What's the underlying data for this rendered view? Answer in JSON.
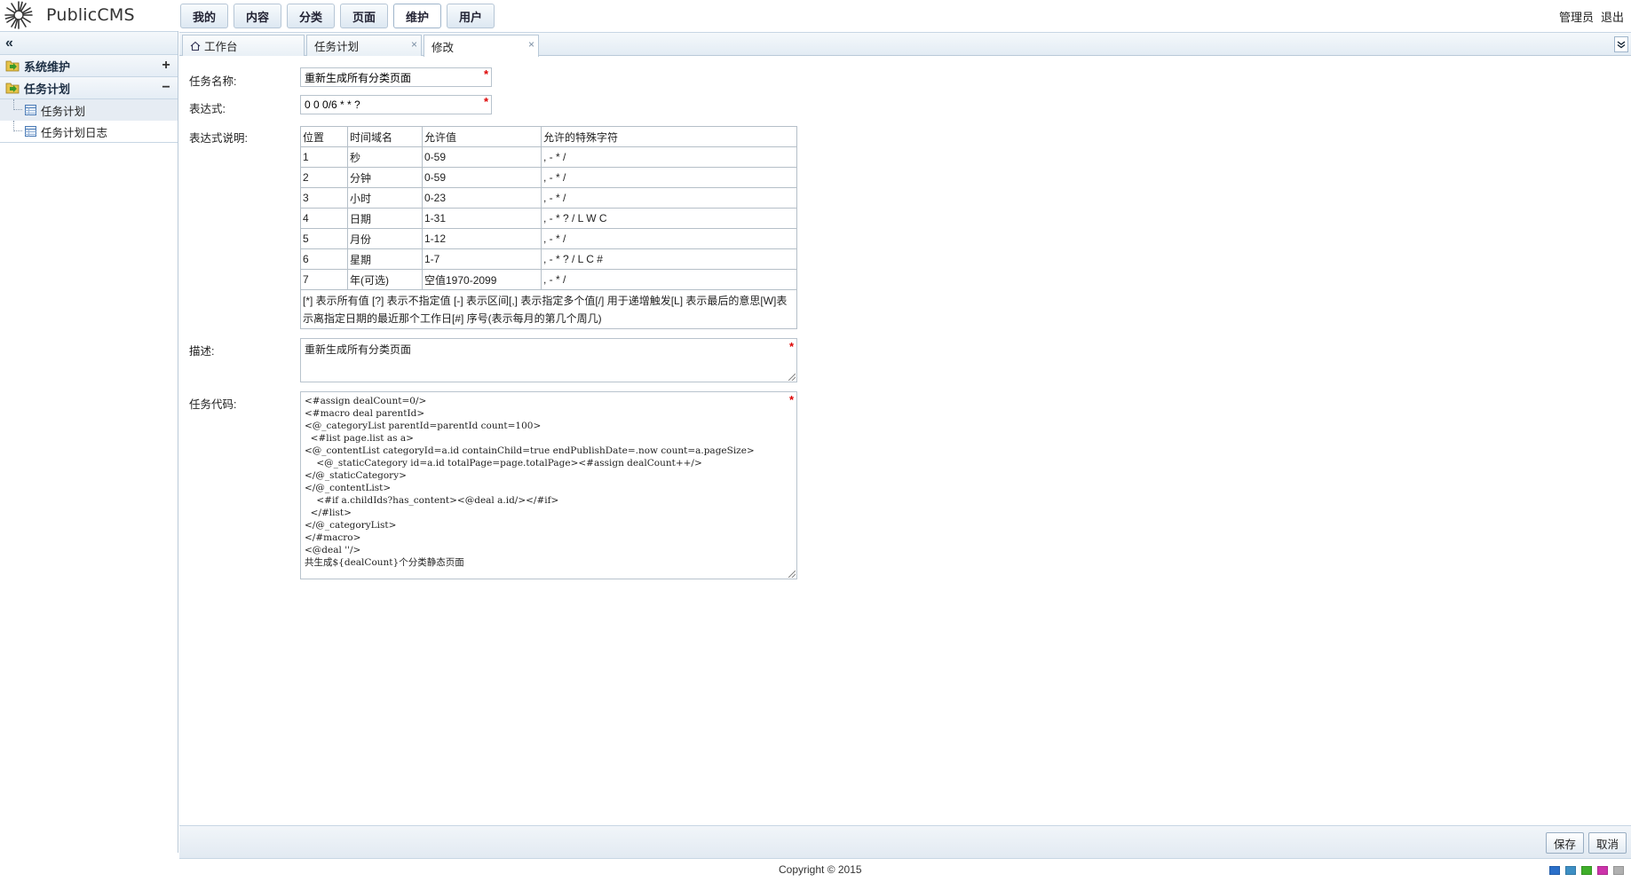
{
  "app": {
    "logo_text": "PublicCMS"
  },
  "topnav": {
    "items": [
      {
        "label": "我的"
      },
      {
        "label": "内容"
      },
      {
        "label": "分类"
      },
      {
        "label": "页面"
      },
      {
        "label": "维护"
      },
      {
        "label": "用户"
      }
    ],
    "active_index": 4
  },
  "userbar": {
    "user_label": "管理员",
    "logout_label": "退出"
  },
  "sidebar": {
    "collapse_glyph": "«",
    "sections": [
      {
        "label": "系统维护",
        "toggle": "+"
      },
      {
        "label": "任务计划",
        "toggle": "−"
      }
    ],
    "items": [
      {
        "label": "任务计划"
      },
      {
        "label": "任务计划日志"
      }
    ],
    "selected_index": 0
  },
  "tabs": {
    "items": [
      {
        "label": "工作台"
      },
      {
        "label": "任务计划"
      },
      {
        "label": "修改"
      }
    ],
    "active_index": 2,
    "close_glyph": "×",
    "expand_glyph": "⌄"
  },
  "form": {
    "name_label": "任务名称:",
    "name_value": "重新生成所有分类页面",
    "cron_label": "表达式:",
    "cron_value": "0 0 0/6 * * ?",
    "cron_help_label": "表达式说明:",
    "description_label": "描述:",
    "description_value": "重新生成所有分类页面",
    "code_label": "任务代码:",
    "required_mark": "*",
    "code_lines": [
      "<#assign dealCount=0/>",
      "<#macro deal parentId>",
      "<@_categoryList parentId=parentId count=100>",
      "  <#list page.list as a>",
      "<@_contentList categoryId=a.id containChild=true endPublishDate=.now count=a.pageSize>",
      "    <@_staticCategory id=a.id totalPage=page.totalPage><#assign dealCount++/>",
      "</@_staticCategory>",
      "</@_contentList>",
      "    <#if a.childIds?has_content><@deal a.id/></#if>",
      "  </#list>",
      "</@_categoryList>",
      "</#macro>",
      "<@deal ''/>",
      "共生成${dealCount}个分类静态页面"
    ]
  },
  "cron_table": {
    "headers": [
      "位置",
      "时间域名",
      "允许值",
      "允许的特殊字符"
    ],
    "rows": [
      [
        "1",
        "秒",
        "0-59",
        ", - * /"
      ],
      [
        "2",
        "分钟",
        "0-59",
        ", - * /"
      ],
      [
        "3",
        "小时",
        "0-23",
        ", - * /"
      ],
      [
        "4",
        "日期",
        "1-31",
        ", - * ? / L W C"
      ],
      [
        "5",
        "月份",
        "1-12",
        ", - * /"
      ],
      [
        "6",
        "星期",
        "1-7",
        ", - * ? / L C #"
      ],
      [
        "7",
        "年(可选)",
        "空值1970-2099",
        ", - * /"
      ]
    ],
    "note": "[*] 表示所有值 [?] 表示不指定值 [-] 表示区间[,] 表示指定多个值[/] 用于递增触发[L] 表示最后的意思[W]表示离指定日期的最近那个工作日[#] 序号(表示每月的第几个周几)"
  },
  "footer": {
    "save_label": "保存",
    "cancel_label": "取消",
    "copyright": "Copyright © 2015",
    "themes": [
      {
        "name": "blue",
        "color": "#2a6fc9"
      },
      {
        "name": "azure",
        "color": "#3d8fc4"
      },
      {
        "name": "green",
        "color": "#3fae2a"
      },
      {
        "name": "purple",
        "color": "#cc33aa"
      },
      {
        "name": "silver",
        "color": "#b0b0b0"
      }
    ]
  }
}
